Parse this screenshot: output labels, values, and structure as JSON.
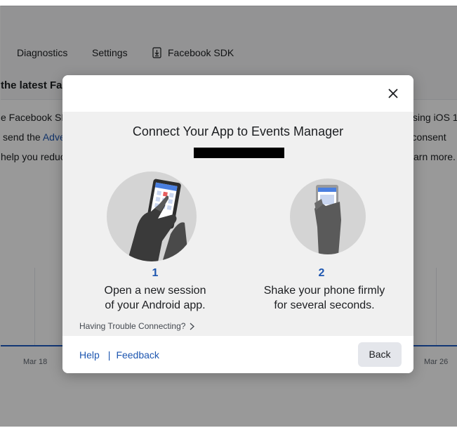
{
  "nav": {
    "diagnostics": "Diagnostics",
    "settings": "Settings",
    "facebook_sdk": "Facebook SDK"
  },
  "background": {
    "heading_fragment": "the latest Fa",
    "left_line1": "e Facebook SD",
    "left_line2_prefix": "send the ",
    "left_line2_link": "Adve",
    "left_line3": "help you reduc",
    "right_line1": "sing iOS 1",
    "right_line2": "r consent",
    "right_line3": "arn more.",
    "chart_ticks": [
      "Mar 18",
      "Mar 26"
    ]
  },
  "modal": {
    "title": "Connect Your App to Events Manager",
    "steps": [
      {
        "number": "1",
        "line1": "Open a new session",
        "line2": "of your Android app."
      },
      {
        "number": "2",
        "line1": "Shake your phone firmly",
        "line2": "for several seconds."
      }
    ],
    "trouble_link": "Having Trouble Connecting?",
    "footer": {
      "help": "Help",
      "separator": "|",
      "feedback": "Feedback",
      "back": "Back"
    }
  },
  "colors": {
    "accent": "#1d56b0",
    "overlay": "rgba(0,0,0,0.40)",
    "chart_line": "#1f5bc4"
  },
  "icons": {
    "close": "close-icon",
    "chevron": "chevron-right-icon",
    "sdk": "download-phone-icon"
  }
}
